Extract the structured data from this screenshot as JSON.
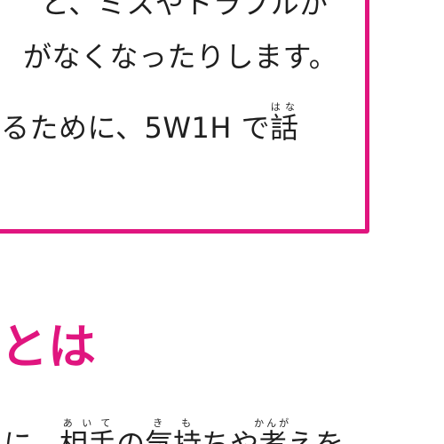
{
  "document": {
    "box": {
      "border_color": "#e0157f",
      "line1": "と、ミスやトラブルが",
      "line2": "がなくなったりします。",
      "line3_before": "るために、5W1H で",
      "line3_kanji": "話",
      "line3_ruby": "はな"
    },
    "heading": {
      "text": "とは",
      "color": "#e0157f"
    },
    "bottom_line": {
      "prefix": "に、",
      "word1_kanji": "相手",
      "word1_ruby": "あいて",
      "particle1": "の",
      "word2_kanji": "気持",
      "word2_ruby": "きも",
      "word2_suffix": "ちや",
      "word3_kanji": "考",
      "word3_ruby": "かんが",
      "suffix": "えを"
    }
  }
}
